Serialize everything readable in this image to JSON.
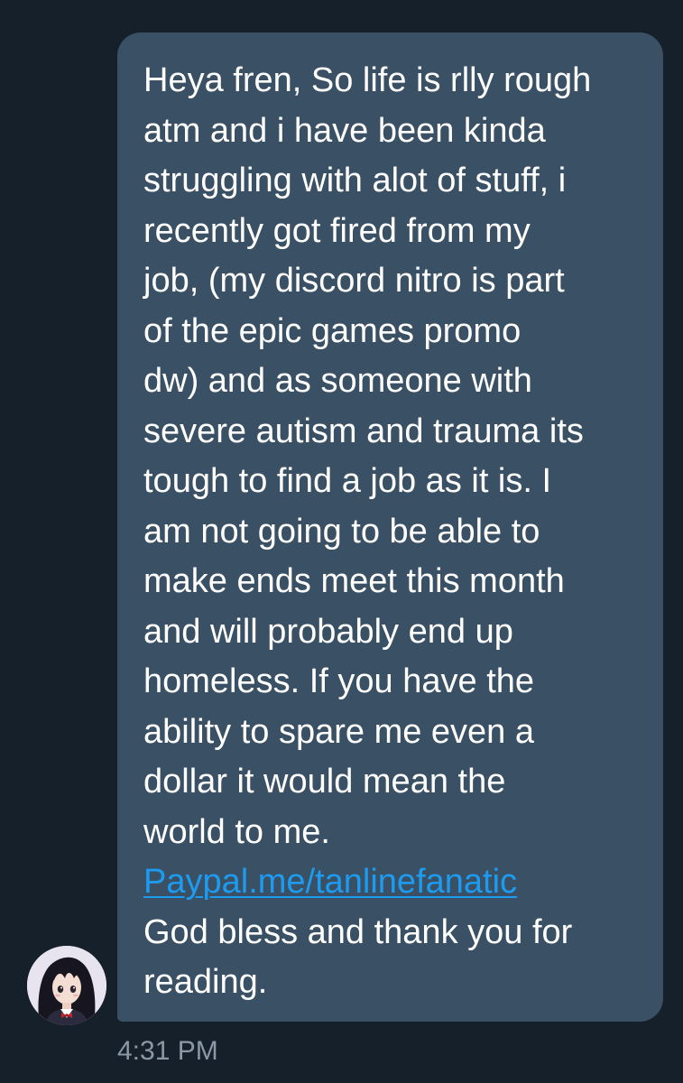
{
  "message": {
    "lines": [
      "Heya fren, So life is rlly rough",
      "atm and i have been kinda",
      "struggling with alot of stuff, i",
      "recently got fired from my",
      "job, (my discord nitro is part",
      "of the epic games promo",
      "dw) and as someone with",
      "severe autism and trauma its",
      "tough to find a job as it is. I",
      "am not going to be able to",
      "make ends meet this month",
      "and will probably end up",
      "homeless. If you have the",
      "ability to spare me even a",
      "dollar it would mean the",
      "world to me."
    ],
    "link_text": "Paypal.me/tanlinefanatic",
    "closing_lines": [
      "God bless and thank you for",
      "reading."
    ],
    "timestamp": "4:31 PM"
  },
  "colors": {
    "background": "#15202b",
    "bubble": "#3a5165",
    "text": "#ffffff",
    "link": "#1d9bf0",
    "timestamp": "#8b98a5"
  },
  "avatar": {
    "icon": "anime-character-avatar"
  }
}
